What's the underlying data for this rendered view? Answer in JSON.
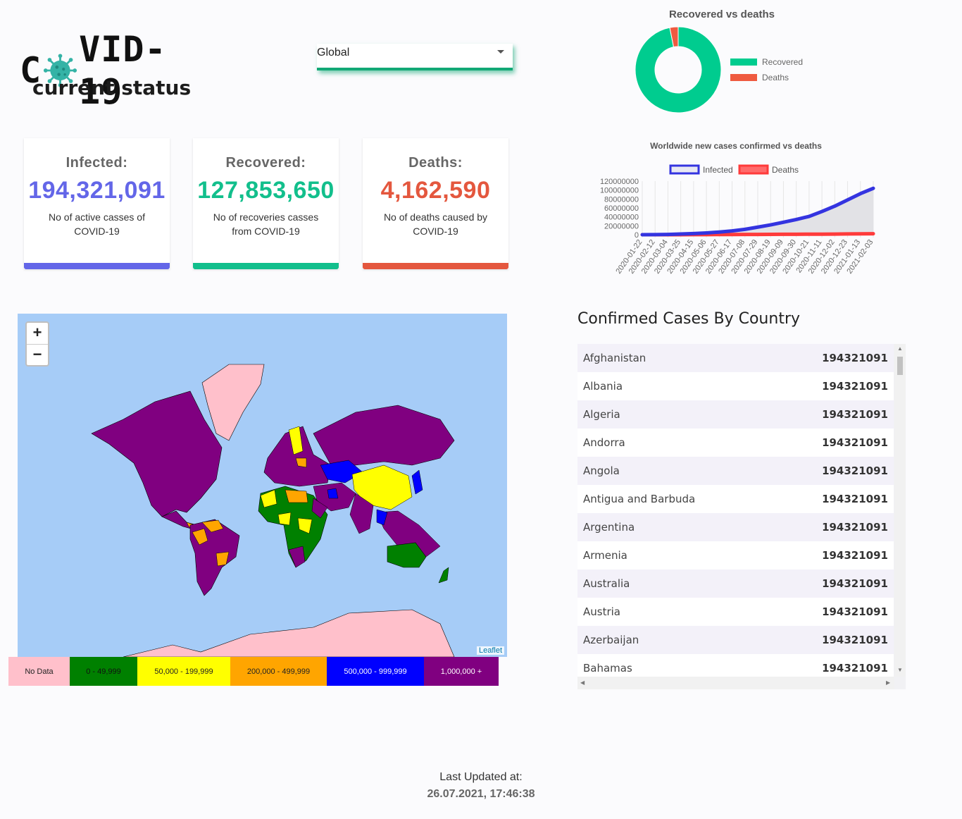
{
  "header": {
    "logo_prefix": "C",
    "logo_suffix": "VID-19",
    "subtitle": "current status"
  },
  "region_select": {
    "value": "Global"
  },
  "cards": {
    "infected": {
      "title": "Infected:",
      "value": "194,321,091",
      "description": "No of active casses of COVID-19",
      "color": "#6366e8"
    },
    "recovered": {
      "title": "Recovered:",
      "value": "127,853,650",
      "description": "No of recoveries casses from COVID-19",
      "color": "#12bf8c"
    },
    "deaths": {
      "title": "Deaths:",
      "value": "4,162,590",
      "description": "No of deaths caused by COVID-19",
      "color": "#e4573e"
    }
  },
  "chart_data": [
    {
      "type": "pie",
      "title": "Recovered vs deaths",
      "labels": [
        "Recovered",
        "Deaths"
      ],
      "values": [
        127853650,
        4162590
      ],
      "colors": [
        "#00cc8f",
        "#ef5a40"
      ],
      "legend": "right"
    },
    {
      "type": "line",
      "title": "Worldwide new cases confirmed vs deaths",
      "x": [
        "2020-01-22",
        "2020-02-12",
        "2020-03-04",
        "2020-03-25",
        "2020-04-15",
        "2020-05-06",
        "2020-05-27",
        "2020-06-17",
        "2020-07-08",
        "2020-07-29",
        "2020-08-19",
        "2020-09-09",
        "2020-09-30",
        "2020-10-21",
        "2020-11-11",
        "2020-12-02",
        "2020-12-23",
        "2021-01-13",
        "2021-02-03"
      ],
      "yticks": [
        "120000000",
        "100000000",
        "80000000",
        "60000000",
        "40000000",
        "20000000",
        "0"
      ],
      "ylim": [
        0,
        120000000
      ],
      "legend": "top",
      "series": [
        {
          "name": "Infected",
          "color": "#3434e0",
          "values": [
            0,
            100000,
            500000,
            1500000,
            2500000,
            4000000,
            6000000,
            8500000,
            12000000,
            17000000,
            22000000,
            28000000,
            34000000,
            41000000,
            52000000,
            64000000,
            78000000,
            92000000,
            104000000
          ]
        },
        {
          "name": "Deaths",
          "color": "#ff3b3b",
          "values": [
            0,
            2000,
            10000,
            40000,
            130000,
            260000,
            360000,
            450000,
            550000,
            660000,
            780000,
            900000,
            1000000,
            1130000,
            1280000,
            1480000,
            1750000,
            2000000,
            2250000
          ]
        }
      ]
    }
  ],
  "map": {
    "zoom_in": "+",
    "zoom_out": "−",
    "attribution": "Leaflet",
    "legend": [
      {
        "label": "No Data",
        "color": "#ffc0cb",
        "text_color": "#222"
      },
      {
        "label": "0 - 49,999",
        "color": "#008000",
        "text_color": "#111"
      },
      {
        "label": "50,000 - 199,999",
        "color": "#ffff00",
        "text_color": "#222"
      },
      {
        "label": "200,000 - 499,999",
        "color": "#ffa500",
        "text_color": "#222"
      },
      {
        "label": "500,000 - 999,999",
        "color": "#0000ff",
        "text_color": "#fff"
      },
      {
        "label": "1,000,000 +",
        "color": "#800080",
        "text_color": "#fff"
      }
    ]
  },
  "country_list": {
    "title": "Confirmed Cases By Country",
    "rows": [
      {
        "name": "Afghanistan",
        "value": "194321091"
      },
      {
        "name": "Albania",
        "value": "194321091"
      },
      {
        "name": "Algeria",
        "value": "194321091"
      },
      {
        "name": "Andorra",
        "value": "194321091"
      },
      {
        "name": "Angola",
        "value": "194321091"
      },
      {
        "name": "Antigua and Barbuda",
        "value": "194321091"
      },
      {
        "name": "Argentina",
        "value": "194321091"
      },
      {
        "name": "Armenia",
        "value": "194321091"
      },
      {
        "name": "Australia",
        "value": "194321091"
      },
      {
        "name": "Austria",
        "value": "194321091"
      },
      {
        "name": "Azerbaijan",
        "value": "194321091"
      },
      {
        "name": "Bahamas",
        "value": "194321091"
      }
    ]
  },
  "footer": {
    "label": "Last Updated at:",
    "value": "26.07.2021, 17:46:38"
  }
}
